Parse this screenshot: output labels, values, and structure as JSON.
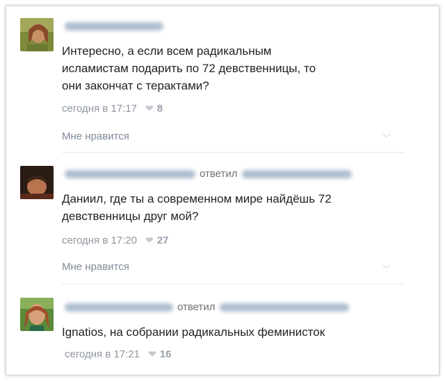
{
  "comments": [
    {
      "reply_word": "",
      "text_lines": [
        "Интересно, а если всем радикальным",
        "исламистам подарить по 72 девственницы, то",
        "они закончат с терактами?"
      ],
      "time": "сегодня в 17:17",
      "likes": "8",
      "like_label": "Мне нравится"
    },
    {
      "reply_word": "ответил",
      "text_lines": [
        "Даниил, где ты а современном мире найдёшь 72",
        "девственницы друг мой?"
      ],
      "time": "сегодня в 17:20",
      "likes": "27",
      "like_label": "Мне нравится"
    },
    {
      "reply_word": "ответил",
      "text_lines": [
        "Ignatios, на собрании радикальных феминисток"
      ],
      "time": "сегодня в 17:21",
      "likes": "16"
    }
  ],
  "icons": {
    "heart": "heart-icon",
    "chevron": "chevron-down-icon"
  },
  "colors": {
    "link": "#7f8a98",
    "meta": "#8f96a0",
    "text": "#222222",
    "blurred_name": "#9fb2c8"
  }
}
